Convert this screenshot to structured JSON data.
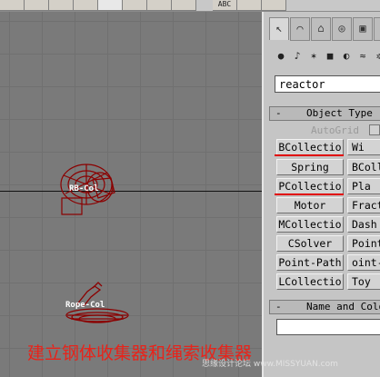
{
  "toolbar": {
    "buttons": [
      "",
      "",
      "",
      "",
      "",
      "",
      "",
      "",
      "ABC",
      "",
      ""
    ]
  },
  "viewport": {
    "objects": [
      {
        "label": "RB-Col",
        "icon": "rigid-body-collection-icon"
      },
      {
        "label": "Rope-Col",
        "icon": "rope-collection-icon"
      }
    ]
  },
  "command_panel": {
    "tabs": [
      "create-tab",
      "modify-tab",
      "hierarchy-tab",
      "motion-tab",
      "display-tab",
      "utilities-tab"
    ],
    "category_icons": [
      "geometry-icon",
      "shapes-icon",
      "lights-icon",
      "cameras-icon",
      "helpers-icon",
      "spacewarps-icon",
      "systems-icon"
    ],
    "dropdown_value": "reactor",
    "object_type": {
      "header": "Object Type",
      "minus": "-",
      "autogrid_label": "AutoGrid",
      "buttons": [
        [
          "BCollectio",
          "Wi"
        ],
        [
          "Spring",
          "BColl"
        ],
        [
          "PCollectio",
          "Pla"
        ],
        [
          "Motor",
          "Fract"
        ],
        [
          "MCollectio",
          "Dash"
        ],
        [
          "CSolver",
          "Point"
        ],
        [
          "Point-Path",
          "oint-"
        ],
        [
          "LCollectio",
          "Toy"
        ]
      ]
    },
    "name_color": {
      "header": "Name and Colo",
      "minus": "-",
      "name_value": ""
    }
  },
  "caption": "建立钢体收集器和绳索收集器",
  "watermark": "思缘设计论坛 www.MISSYUAN.com",
  "colors": {
    "viewport_bg": "#7a7a7a",
    "panel_bg": "#c5c5c5",
    "caption_red": "#e8231a",
    "highlight_red": "#e00000",
    "object_red": "#8b0000"
  }
}
